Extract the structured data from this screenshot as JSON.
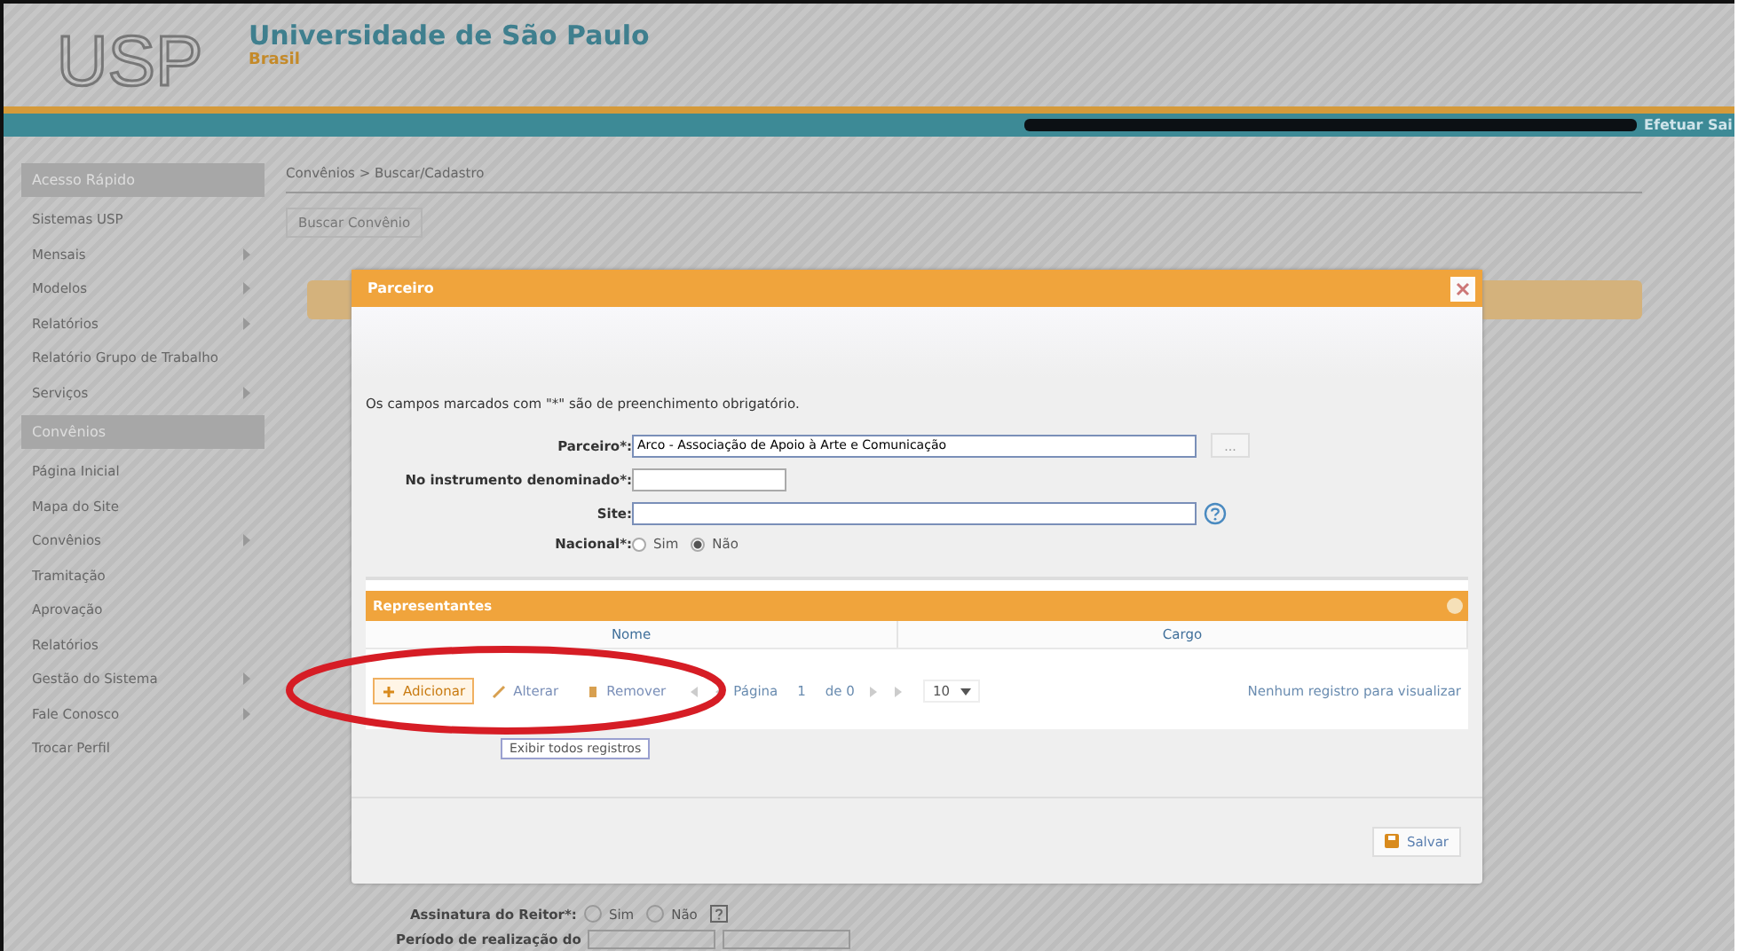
{
  "header": {
    "logo": "USP",
    "title": "Universidade de São Paulo",
    "subtitle": "Brasil",
    "logout": "Efetuar Sai"
  },
  "sidebar": {
    "sections": [
      {
        "title": "Acesso Rápido",
        "items": [
          {
            "label": "Sistemas USP",
            "submenu": false
          },
          {
            "label": "Mensais",
            "submenu": true
          },
          {
            "label": "Modelos",
            "submenu": true
          },
          {
            "label": "Relatórios",
            "submenu": true
          },
          {
            "label": "Relatório Grupo de Trabalho",
            "submenu": false
          },
          {
            "label": "Serviços",
            "submenu": true
          }
        ]
      },
      {
        "title": "Convênios",
        "items": [
          {
            "label": "Página Inicial",
            "submenu": false
          },
          {
            "label": "Mapa do Site",
            "submenu": false
          },
          {
            "label": "Convênios",
            "submenu": true
          },
          {
            "label": "Tramitação",
            "submenu": false
          },
          {
            "label": "Aprovação",
            "submenu": false
          },
          {
            "label": "Relatórios",
            "submenu": false
          },
          {
            "label": "Gestão do Sistema",
            "submenu": true
          },
          {
            "label": "Fale Conosco",
            "submenu": true
          },
          {
            "label": "Trocar Perfil",
            "submenu": false
          }
        ]
      }
    ]
  },
  "content": {
    "breadcrumb": "Convênios > Buscar/Cadastro",
    "tab": "Buscar Convênio",
    "fields": [
      {
        "label": "Assinatura do Reitor*:",
        "kind": "radio",
        "options": [
          {
            "label": "Sim",
            "selected": false
          },
          {
            "label": "Não",
            "selected": false
          }
        ]
      },
      {
        "label": "Período de realização do",
        "kind": "dates"
      }
    ]
  },
  "dialog": {
    "title": "Parceiro",
    "note": "Os campos marcados com \"*\" são de preenchimento obrigatório.",
    "fields": [
      {
        "label": "Parceiro*:",
        "kind": "lookup",
        "value": "Arco - Associação de Apoio à Arte e Comunicação",
        "button": "..."
      },
      {
        "label": "No instrumento denominado*:",
        "kind": "short"
      },
      {
        "label": "Site:",
        "kind": "help"
      },
      {
        "label": "Nacional*:",
        "kind": "radio",
        "options": [
          {
            "label": "Sim",
            "selected": false
          },
          {
            "label": "Não",
            "selected": true
          }
        ]
      }
    ],
    "panel": {
      "title": "Representantes",
      "columns": [
        "Nome",
        "Cargo"
      ],
      "actions": [
        {
          "label": "Adicionar",
          "kind": "add",
          "highlighted": true
        },
        {
          "label": "Alterar",
          "kind": "edit",
          "highlighted": false
        },
        {
          "label": "Remover",
          "kind": "remove",
          "highlighted": false
        }
      ],
      "pager": {
        "page_label": "Página",
        "page": "1",
        "total": "de 0",
        "rows": "10",
        "empty": "Nenhum registro para visualizar"
      }
    },
    "show_all": "Exibir todos registros",
    "save": "Salvar"
  }
}
